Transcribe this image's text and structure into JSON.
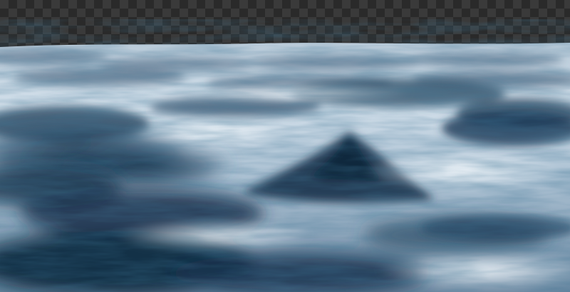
{
  "image": {
    "subject": "ocean-waves",
    "background": "transparency-checkerboard",
    "colors": {
      "checker_light": "#3a3a3a",
      "checker_dark": "#2a2a2a",
      "deep_water": "#1f3a55",
      "mid_water": "#4d6d8a",
      "foam": "#e6eef4",
      "light_water": "#c6d5e1"
    }
  }
}
